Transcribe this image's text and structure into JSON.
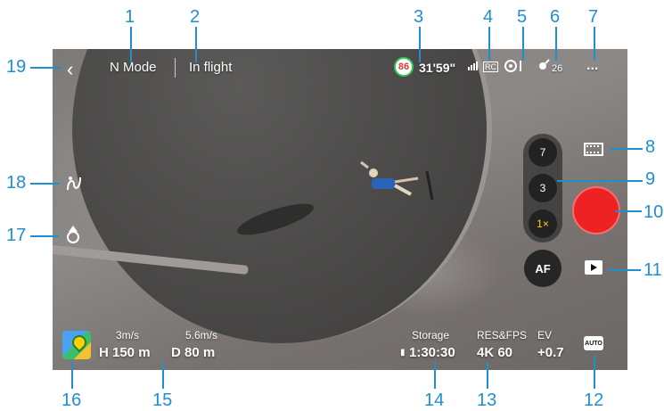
{
  "callouts": [
    "1",
    "2",
    "3",
    "4",
    "5",
    "6",
    "7",
    "8",
    "9",
    "10",
    "11",
    "12",
    "13",
    "14",
    "15",
    "16",
    "17",
    "18",
    "19"
  ],
  "header": {
    "back_icon": "chevron-left-icon",
    "mode": "N Mode",
    "flight_status": "In flight",
    "battery_percent": "86",
    "flight_time": "31'59\"",
    "rc_signal_label": "RC",
    "gps_count": "26",
    "more_icon": "..."
  },
  "camera": {
    "zoom_levels": [
      "7",
      "3",
      "1×"
    ],
    "af_label": "AF"
  },
  "telemetry": {
    "vertical_speed": "3m/s",
    "horizontal_speed": "5.6m/s",
    "height": "H 150 m",
    "distance": "D 80 m"
  },
  "info": {
    "storage_label": "Storage",
    "storage_value": "1:30:30",
    "res_label": "RES&FPS",
    "res_value": "4K 60",
    "ev_label": "EV",
    "ev_value": "+0.7",
    "auto_label": "AUTO"
  },
  "colors": {
    "callout": "#1f8fd1",
    "record": "#ee2222",
    "battery_ring": "#35c759"
  }
}
